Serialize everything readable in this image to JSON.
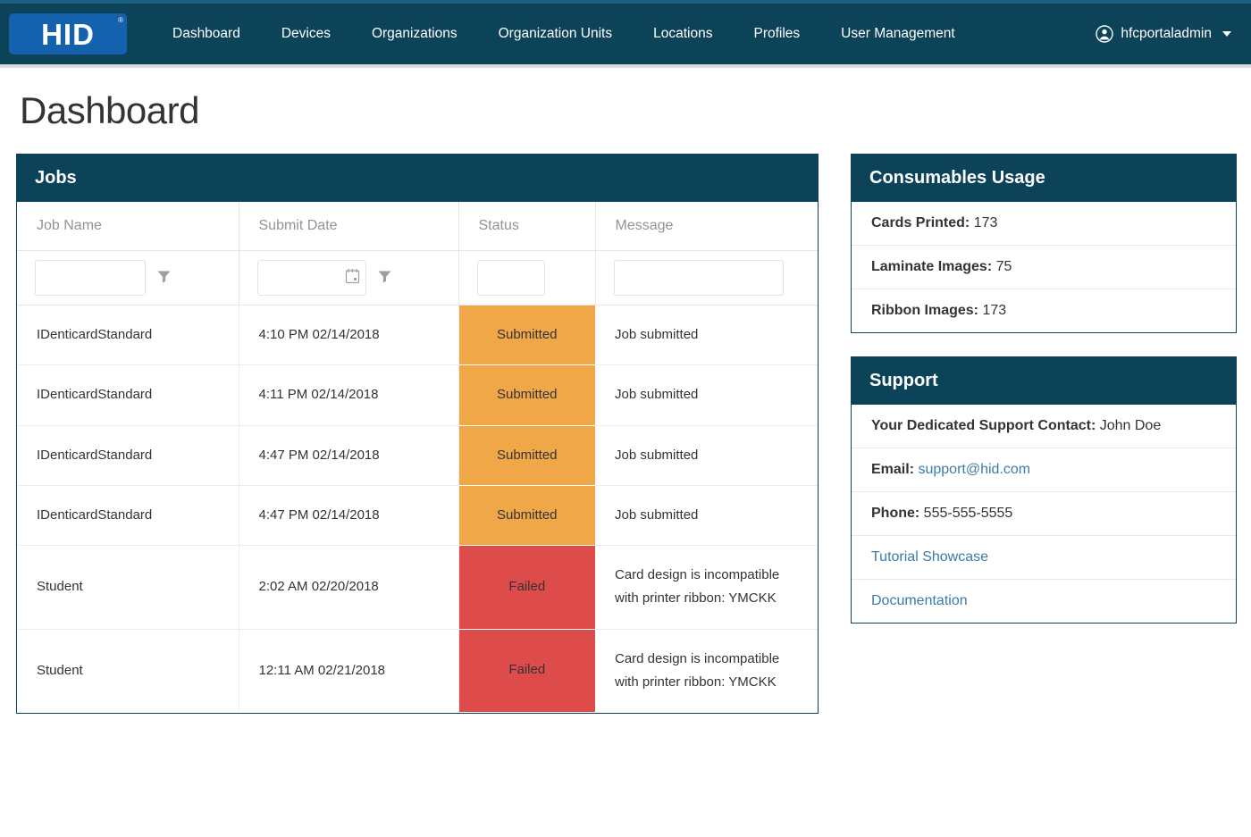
{
  "navbar": {
    "logo_text": "HID",
    "logo_registered": "®",
    "links": [
      {
        "label": "Dashboard"
      },
      {
        "label": "Devices"
      },
      {
        "label": "Organizations"
      },
      {
        "label": "Organization Units"
      },
      {
        "label": "Locations"
      },
      {
        "label": "Profiles"
      },
      {
        "label": "User Management"
      }
    ],
    "user": {
      "name": "hfcportaladmin",
      "icon": "user-circle-icon",
      "caret": "chevron-down-icon"
    }
  },
  "page": {
    "title": "Dashboard"
  },
  "jobs": {
    "panel_title": "Jobs",
    "columns": [
      {
        "key": "job_name",
        "label": "Job Name"
      },
      {
        "key": "submit_date",
        "label": "Submit Date"
      },
      {
        "key": "status",
        "label": "Status"
      },
      {
        "key": "message",
        "label": "Message"
      }
    ],
    "filters": {
      "job_name": {
        "value": "",
        "placeholder": "",
        "icon": "filter-funnel-icon"
      },
      "submit_date": {
        "value": "",
        "placeholder": "",
        "icon": "filter-funnel-icon",
        "field_icon": "calendar-icon"
      },
      "status": {
        "value": "",
        "placeholder": ""
      },
      "message": {
        "value": "",
        "placeholder": ""
      }
    },
    "rows": [
      {
        "job_name": "IDenticardStandard",
        "submit_date": "4:10 PM 02/14/2018",
        "status": "Submitted",
        "status_kind": "submitted",
        "message": "Job submitted"
      },
      {
        "job_name": "IDenticardStandard",
        "submit_date": "4:11 PM 02/14/2018",
        "status": "Submitted",
        "status_kind": "submitted",
        "message": "Job submitted"
      },
      {
        "job_name": "IDenticardStandard",
        "submit_date": "4:47 PM 02/14/2018",
        "status": "Submitted",
        "status_kind": "submitted",
        "message": "Job submitted"
      },
      {
        "job_name": "IDenticardStandard",
        "submit_date": "4:47 PM 02/14/2018",
        "status": "Submitted",
        "status_kind": "submitted",
        "message": "Job submitted"
      },
      {
        "job_name": "Student",
        "submit_date": "2:02 AM 02/20/2018",
        "status": "Failed",
        "status_kind": "failed",
        "message": "Card design is incompatible with printer ribbon: YMCKK"
      },
      {
        "job_name": "Student",
        "submit_date": "12:11 AM 02/21/2018",
        "status": "Failed",
        "status_kind": "failed",
        "message": "Card design is incompatible with printer ribbon: YMCKK"
      }
    ]
  },
  "consumables": {
    "panel_title": "Consumables Usage",
    "rows": [
      {
        "label": "Cards Printed:",
        "value": "173"
      },
      {
        "label": "Laminate Images:",
        "value": "75"
      },
      {
        "label": "Ribbon Images:",
        "value": "173"
      }
    ]
  },
  "support": {
    "panel_title": "Support",
    "contact_label": "Your Dedicated Support Contact:",
    "contact_value": "John Doe",
    "email_label": "Email:",
    "email_value": "support@hid.com",
    "phone_label": "Phone:",
    "phone_value": "555-555-5555",
    "links": [
      {
        "label": "Tutorial Showcase"
      },
      {
        "label": "Documentation"
      }
    ]
  },
  "colors": {
    "navbar_bg": "#0d4359",
    "panel_header_bg": "#0d4359",
    "logo_bg": "#1462ae",
    "status_submitted": "#efa747",
    "status_failed": "#dd4b4b",
    "link": "#3a7ca8"
  }
}
